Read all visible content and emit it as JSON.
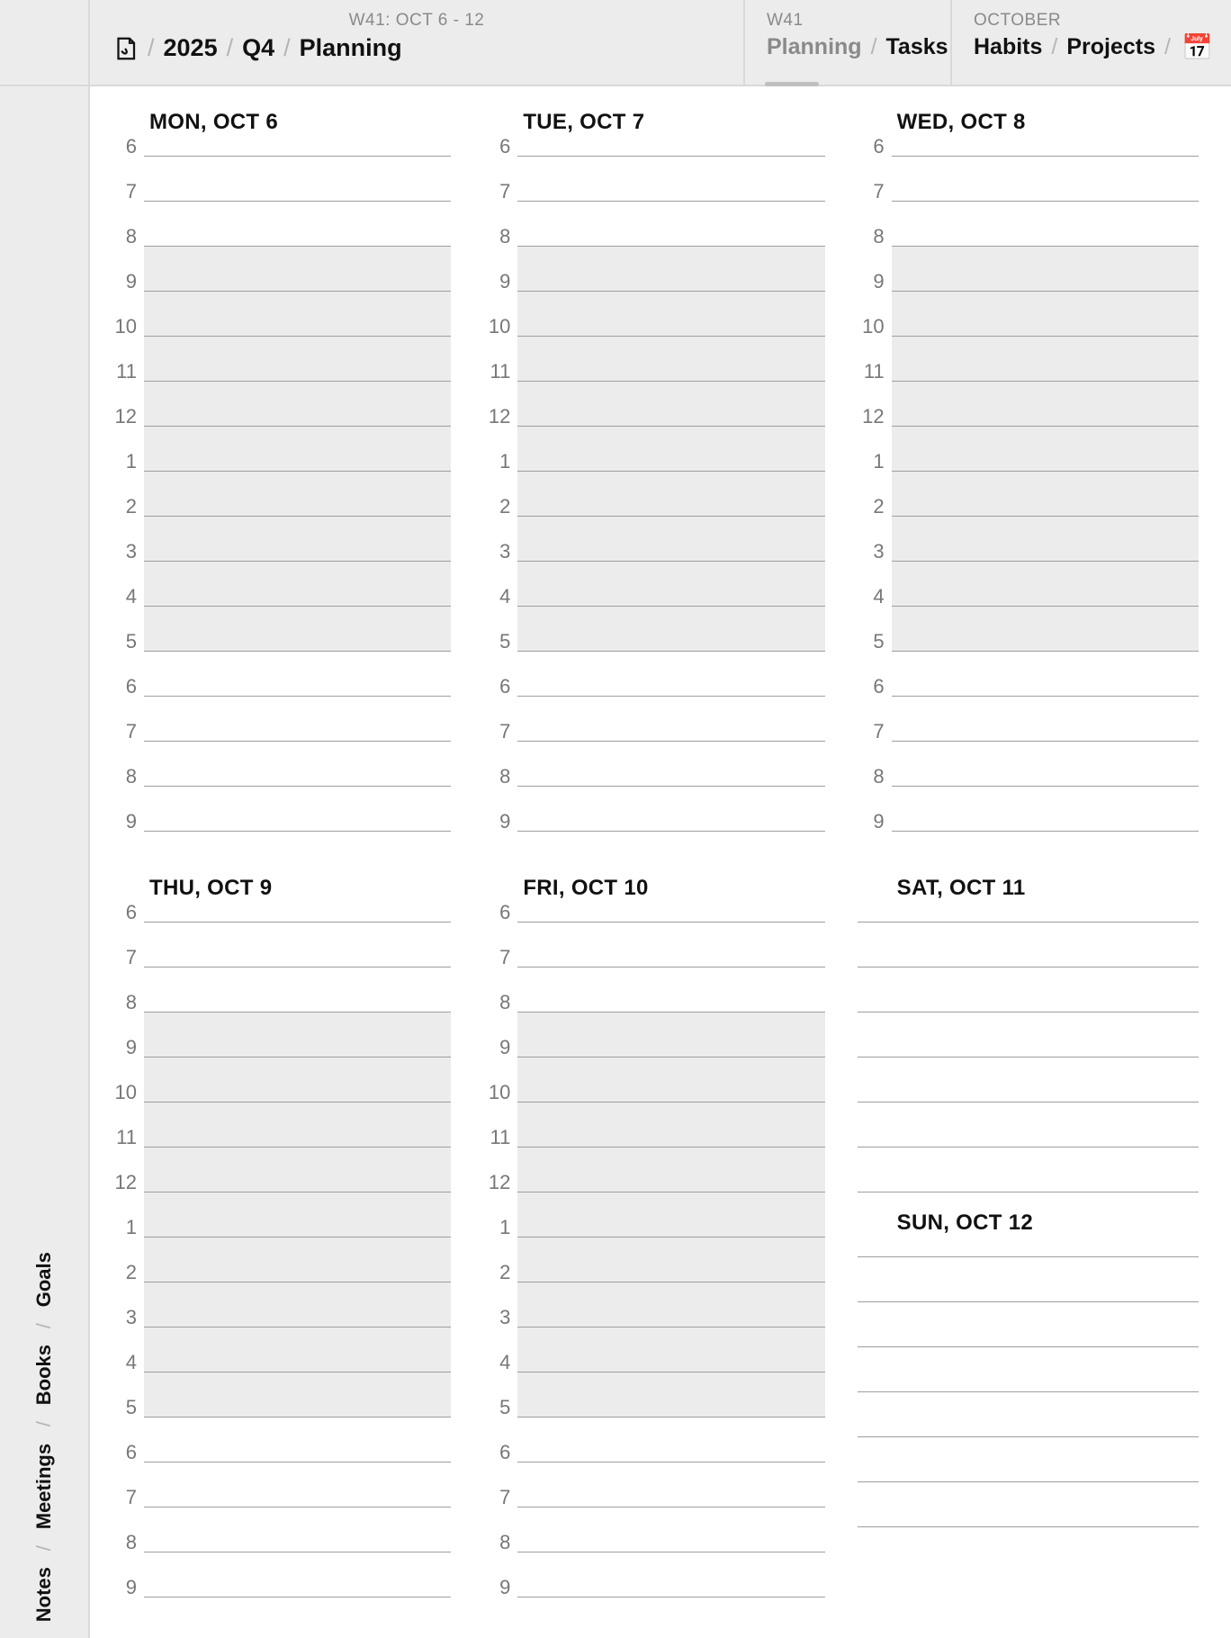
{
  "header": {
    "tab1": {
      "eyebrow": "W41: OCT 6 - 12",
      "crumbs": [
        "2025",
        "Q4",
        "Planning"
      ]
    },
    "tab2": {
      "eyebrow": "W41",
      "dim": "Planning",
      "active": "Tasks"
    },
    "tab3": {
      "eyebrow": "OCTOBER",
      "items": [
        "Habits",
        "Projects"
      ],
      "calendar_icon": "📅"
    }
  },
  "sidebar": {
    "links": [
      "Notes",
      "Meetings",
      "Books",
      "Goals"
    ]
  },
  "hours": [
    "6",
    "7",
    "8",
    "9",
    "10",
    "11",
    "12",
    "1",
    "2",
    "3",
    "4",
    "5",
    "6",
    "7",
    "8",
    "9"
  ],
  "work_indices": [
    3,
    4,
    5,
    6,
    7,
    8,
    9,
    10,
    11
  ],
  "weekdays": [
    {
      "label": "MON, OCT 6"
    },
    {
      "label": "TUE, OCT 7"
    },
    {
      "label": "WED, OCT 8"
    },
    {
      "label": "THU, OCT 9"
    },
    {
      "label": "FRI, OCT 10"
    }
  ],
  "weekend": {
    "sat": {
      "label": "SAT, OCT 11",
      "lines": 7
    },
    "sun": {
      "label": "SUN, OCT 12",
      "lines": 7
    }
  }
}
